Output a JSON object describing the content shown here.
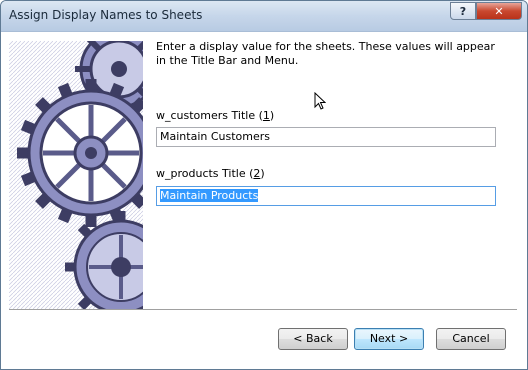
{
  "window": {
    "title": "Assign Display Names to Sheets",
    "help_label": "?",
    "close_label": "✕"
  },
  "intro": "Enter a display value for the sheets.  These values will appear in the Title Bar and Menu.",
  "fields": [
    {
      "label_prefix": "w_customers Title (",
      "mnemonic": "1",
      "label_suffix": ")",
      "value": "Maintain Customers"
    },
    {
      "label_prefix": "w_products Title (",
      "mnemonic": "2",
      "label_suffix": ")",
      "value": "Maintain Products"
    }
  ],
  "buttons": {
    "back": "< Back",
    "next": "Next >",
    "cancel": "Cancel"
  },
  "colors": {
    "selection": "#3399ff",
    "gear_dark": "#3d3d63",
    "gear_mid": "#8d8fc2",
    "gear_light": "#c8cae6"
  },
  "icons": [
    "gears-illustration",
    "mouse-pointer-icon",
    "close-icon",
    "help-icon"
  ]
}
